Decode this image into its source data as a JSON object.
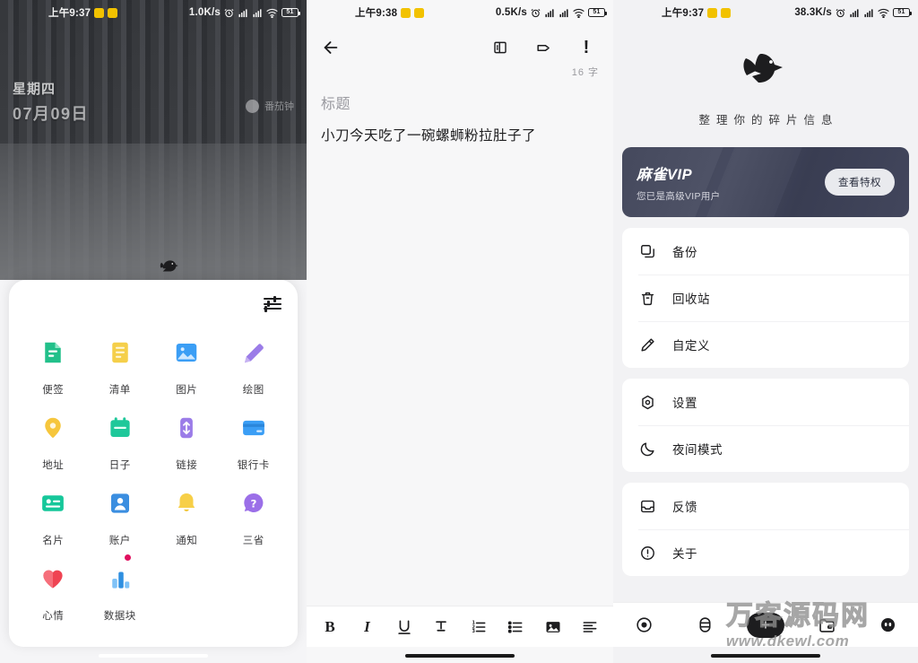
{
  "panel1": {
    "status": {
      "time": "上午9:37",
      "speed": "1.0K/s",
      "battery": "51"
    },
    "wallpaper": {
      "weekday": "星期四",
      "date": "07月09日",
      "widget_label": "番茄钟"
    },
    "sheet": {
      "tune_icon": "tune-icon",
      "items": [
        {
          "label": "便签",
          "icon": "note-icon",
          "color": "#22c08a",
          "badge": false
        },
        {
          "label": "清单",
          "icon": "checklist-icon",
          "color": "#f5cf4a",
          "badge": false
        },
        {
          "label": "图片",
          "icon": "image-icon",
          "color": "#3b9ef5",
          "badge": false
        },
        {
          "label": "绘图",
          "icon": "pencil-icon",
          "color": "#9b7ce8",
          "badge": false
        },
        {
          "label": "地址",
          "icon": "location-pin-icon",
          "color": "#f6c63c",
          "badge": false
        },
        {
          "label": "日子",
          "icon": "calendar-icon",
          "color": "#1ec89a",
          "badge": false
        },
        {
          "label": "链接",
          "icon": "link-icon",
          "color": "#9b7ce8",
          "badge": false
        },
        {
          "label": "银行卡",
          "icon": "bank-card-icon",
          "color": "#3b9ef5",
          "badge": false
        },
        {
          "label": "名片",
          "icon": "contact-card-icon",
          "color": "#16c79a",
          "badge": false
        },
        {
          "label": "账户",
          "icon": "account-icon",
          "color": "#3b8ee0",
          "badge": false
        },
        {
          "label": "通知",
          "icon": "bell-icon",
          "color": "#f7cf47",
          "badge": false
        },
        {
          "label": "三省",
          "icon": "question-icon",
          "color": "#9b6fe8",
          "badge": false
        },
        {
          "label": "心情",
          "icon": "heart-icon",
          "color": "#ef4352",
          "badge": false
        },
        {
          "label": "数据块",
          "icon": "bar-chart-icon",
          "color": "#4aa6f0",
          "badge": true
        }
      ]
    }
  },
  "panel2": {
    "status": {
      "time": "上午9:38",
      "speed": "0.5K/s",
      "battery": "51"
    },
    "topbar": {
      "back_icon": "back-arrow-icon",
      "actions": [
        {
          "name": "panel-layout-icon",
          "glyph": "panel"
        },
        {
          "name": "tag-icon",
          "glyph": "tag"
        },
        {
          "name": "priority-icon",
          "glyph": "!"
        }
      ]
    },
    "word_count": "16 字",
    "title_placeholder": "标题",
    "body_text": "小刀今天吃了一碗螺蛳粉拉肚子了",
    "toolbar": [
      {
        "name": "bold-button",
        "glyph": "B"
      },
      {
        "name": "italic-button",
        "glyph": "I"
      },
      {
        "name": "underline-button",
        "glyph": "U"
      },
      {
        "name": "strikethrough-button",
        "glyph": "S"
      },
      {
        "name": "ordered-list-button",
        "glyph": "ol"
      },
      {
        "name": "bullet-list-button",
        "glyph": "ul"
      },
      {
        "name": "insert-image-button",
        "glyph": "img"
      },
      {
        "name": "align-button",
        "glyph": "align"
      }
    ]
  },
  "panel3": {
    "status": {
      "time": "上午9:37",
      "speed": "38.3K/s",
      "battery": "51"
    },
    "logo_name": "sparrow-logo-icon",
    "slogan": "整理你的碎片信息",
    "vip": {
      "title": "麻雀VIP",
      "subtitle": "您已是高级VIP用户",
      "button": "查看特权"
    },
    "groups": [
      [
        {
          "label": "备份",
          "icon": "copy-icon"
        },
        {
          "label": "回收站",
          "icon": "trash-icon"
        },
        {
          "label": "自定义",
          "icon": "pencil-edit-icon"
        }
      ],
      [
        {
          "label": "设置",
          "icon": "settings-gear-icon"
        },
        {
          "label": "夜间模式",
          "icon": "moon-icon"
        }
      ],
      [
        {
          "label": "反馈",
          "icon": "inbox-icon"
        },
        {
          "label": "关于",
          "icon": "info-circle-icon"
        }
      ]
    ],
    "nav": [
      {
        "name": "nav-record-icon",
        "glyph": "target"
      },
      {
        "name": "nav-capsule-icon",
        "glyph": "capsule"
      },
      {
        "name": "nav-add-button",
        "glyph": "+"
      },
      {
        "name": "nav-folder-icon",
        "glyph": "folder"
      },
      {
        "name": "nav-profile-icon",
        "glyph": "profile"
      }
    ]
  },
  "watermark": {
    "cn": "万客源码网",
    "en": "www.dkewl.com"
  }
}
